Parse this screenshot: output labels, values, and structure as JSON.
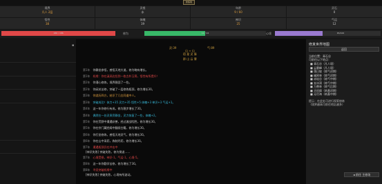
{
  "top_button": "修炼场",
  "stats_row1": [
    {
      "label": "境界",
      "value": "凡人 2层",
      "color": "#e0a040"
    },
    {
      "label": "灵根",
      "value": "水",
      "color": "#cccccc"
    },
    {
      "label": "年龄",
      "value": "9 / 60",
      "color": "#e0a040"
    },
    {
      "label": "灵石",
      "value": "0",
      "color": "#cccccc"
    }
  ],
  "stats_row2": [
    {
      "label": "悟性",
      "value": "38",
      "color": "#e0a040"
    },
    {
      "label": "体魄",
      "value": "19",
      "color": "#cccccc"
    },
    {
      "label": "神识",
      "value": "25",
      "color": "#e0a040"
    },
    {
      "label": "气运",
      "value": "12",
      "color": "#cccccc"
    }
  ],
  "bars": {
    "hp": {
      "text": "186 / 186",
      "fill": 1.0,
      "color": "#e04848"
    },
    "progress": {
      "label": "修为",
      "text": "12 / 24",
      "fill": 0.5,
      "color": "#38b868"
    },
    "mood": {
      "label": "心境",
      "text": "65/100",
      "fill": 0.45,
      "color": "#9a7ad0"
    }
  },
  "terrain": {
    "left": "灵:39",
    "right": "气:89",
    "glyphs": "山 ≈ 山",
    "sub": "宿 星 灵 脉",
    "caption": "群 山 云 雾"
  },
  "log": [
    {
      "t": "第1年",
      "text": "你静坐参悟，感悟天地大道，修为略有增长。",
      "color": "#cccccc"
    },
    {
      "t": "第1年",
      "text": "机缘：你在溪涧边捡到一枚古朴玉简，悟性有所提升！",
      "color": "#e04848"
    },
    {
      "t": "第2年",
      "text": "你潜心修炼，境界稳固了一些。",
      "color": "#cccccc"
    },
    {
      "t": "第2年",
      "text": "你闭关苦修，突破了一层修炼瓶颈，修为增长30。",
      "color": "#cccccc"
    },
    {
      "t": "第3年",
      "text": "你游历四方，结识了几位同道中人。",
      "color": "#e0a040"
    },
    {
      "t": "第3年",
      "text": "突破成功！体力+35 灵力+35 悟性+5 体魄+3 神识+3 气运+1。",
      "color": "#38b8d8"
    },
    {
      "t": "第4年",
      "text": "这一年你修行有成，修为稳步增长了30。",
      "color": "#cccccc"
    },
    {
      "t": "第4年",
      "text": "偶然在一处灵泉旁静坐，灵力恢复了一些，体魄+2。",
      "color": "#38b8d8"
    },
    {
      "t": "第5年",
      "text": "你在荒野中遭遇妖兽，经过激战险胜，修为增长30。",
      "color": "#cccccc"
    },
    {
      "t": "第5年",
      "text": "你在宗门藏经阁中翻阅古籍，修为增长30。",
      "color": "#cccccc"
    },
    {
      "t": "第6年",
      "text": "你打坐修炼，感悟天地灵气，修为增长30。",
      "color": "#cccccc"
    },
    {
      "t": "第6年",
      "text": "你在山中采药，炼制丹药，修为增长30。",
      "color": "#cccccc"
    },
    {
      "t": "第7年",
      "text": "遭遇瓶颈仍在冲击中",
      "color": "#e04848"
    },
    {
      "t": "",
      "text": "[神识失败] 突破失败，修为倒退……",
      "color": "#cccccc"
    },
    {
      "t": "第7年",
      "text": "心境受损，神识-1，气运-1，心境-5。",
      "color": "#e04848"
    },
    {
      "t": "第8年",
      "text": "这一年你勤学苦修，修为增长了30。",
      "color": "#cccccc"
    },
    {
      "t": "第8年",
      "text": "寻觅突破机缘中",
      "color": "#e04848"
    },
    {
      "t": "",
      "text": "[神识失败] 突破失败，心境有所波动。",
      "color": "#cccccc"
    }
  ],
  "right_panel": {
    "title": "修真世界地图",
    "button": "返回",
    "current": "当前位置：青石谷",
    "intro": "可前往以下地点：",
    "places": [
      "青石谷（凡人境）",
      "云雾峰（凡人境）",
      "落日坡（炼气初期）",
      "幽冥林（炼气初期）",
      "赤焰谷（炼气中期）",
      "玄冰洞（炼气中期）",
      "万兽林（炼气后期）",
      "天机阁（筑基初期）",
      "无尽海（筑基中期）"
    ],
    "note1": "提示：在此处可进行探索修炼",
    "note2": "（境界越高可前往地区越多）",
    "back": "◄ 前往 主修场"
  }
}
